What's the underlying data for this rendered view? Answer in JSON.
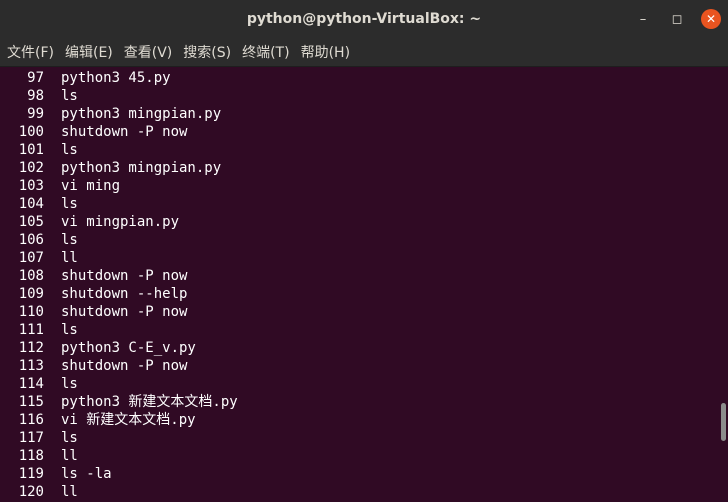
{
  "window": {
    "title": "python@python-VirtualBox: ~",
    "minimize_label": "–",
    "maximize_label": "◻",
    "close_label": "✕"
  },
  "menubar": {
    "items": [
      {
        "label": "文件(F)"
      },
      {
        "label": "编辑(E)"
      },
      {
        "label": "查看(V)"
      },
      {
        "label": "搜索(S)"
      },
      {
        "label": "终端(T)"
      },
      {
        "label": "帮助(H)"
      }
    ]
  },
  "terminal": {
    "lines": [
      {
        "num": "97",
        "cmd": "python3 45.py"
      },
      {
        "num": "98",
        "cmd": "ls"
      },
      {
        "num": "99",
        "cmd": "python3 mingpian.py"
      },
      {
        "num": "100",
        "cmd": "shutdown -P now"
      },
      {
        "num": "101",
        "cmd": "ls"
      },
      {
        "num": "102",
        "cmd": "python3 mingpian.py"
      },
      {
        "num": "103",
        "cmd": "vi ming"
      },
      {
        "num": "104",
        "cmd": "ls"
      },
      {
        "num": "105",
        "cmd": "vi mingpian.py"
      },
      {
        "num": "106",
        "cmd": "ls"
      },
      {
        "num": "107",
        "cmd": "ll"
      },
      {
        "num": "108",
        "cmd": "shutdown -P now"
      },
      {
        "num": "109",
        "cmd": "shutdown --help"
      },
      {
        "num": "110",
        "cmd": "shutdown -P now"
      },
      {
        "num": "111",
        "cmd": "ls"
      },
      {
        "num": "112",
        "cmd": "python3 C-E_v.py"
      },
      {
        "num": "113",
        "cmd": "shutdown -P now"
      },
      {
        "num": "114",
        "cmd": "ls"
      },
      {
        "num": "115",
        "cmd": "python3 新建文本文档.py"
      },
      {
        "num": "116",
        "cmd": "vi 新建文本文档.py"
      },
      {
        "num": "117",
        "cmd": "ls"
      },
      {
        "num": "118",
        "cmd": "ll"
      },
      {
        "num": "119",
        "cmd": "ls -la"
      },
      {
        "num": "120",
        "cmd": "ll"
      }
    ]
  },
  "colors": {
    "terminal_bg": "#300a24",
    "titlebar_bg": "#2c2c2c",
    "close_button": "#e95420",
    "text": "#ffffff"
  }
}
